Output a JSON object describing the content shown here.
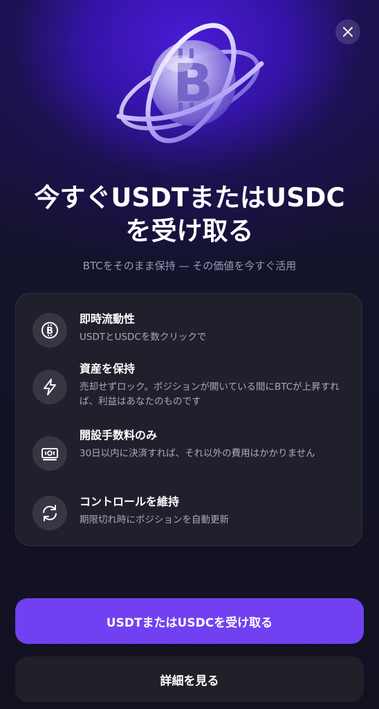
{
  "modal": {
    "title_line1": "今すぐUSDTまたはUSDC",
    "title_line2": "を受け取る",
    "subtitle": "BTCをそのまま保持 — その価値を今すぐ活用",
    "hero_icon": "bitcoin-globe-icon",
    "close_icon": "close-icon"
  },
  "features": [
    {
      "icon": "bitcoin-icon",
      "title": "即時流動性",
      "description": "USDTとUSDCを数クリックで"
    },
    {
      "icon": "lightning-icon",
      "title": "資産を保持",
      "description": "売却せずロック。ポジションが開いている間にBTCが上昇すれば、利益はあなたのものです"
    },
    {
      "icon": "cash-icon",
      "title": "開設手数料のみ",
      "description": "30日以内に決済すれば、それ以外の費用はかかりません"
    },
    {
      "icon": "refresh-icon",
      "title": "コントロールを維持",
      "description": "期限切れ時にポジションを自動更新"
    }
  ],
  "buttons": {
    "primary_label": "USDTまたはUSDCを受け取る",
    "secondary_label": "詳細を見る"
  },
  "colors": {
    "accent": "#7141f1",
    "background": "#111120",
    "card": "#22222e",
    "hero_glow": "#4a1ad6"
  }
}
